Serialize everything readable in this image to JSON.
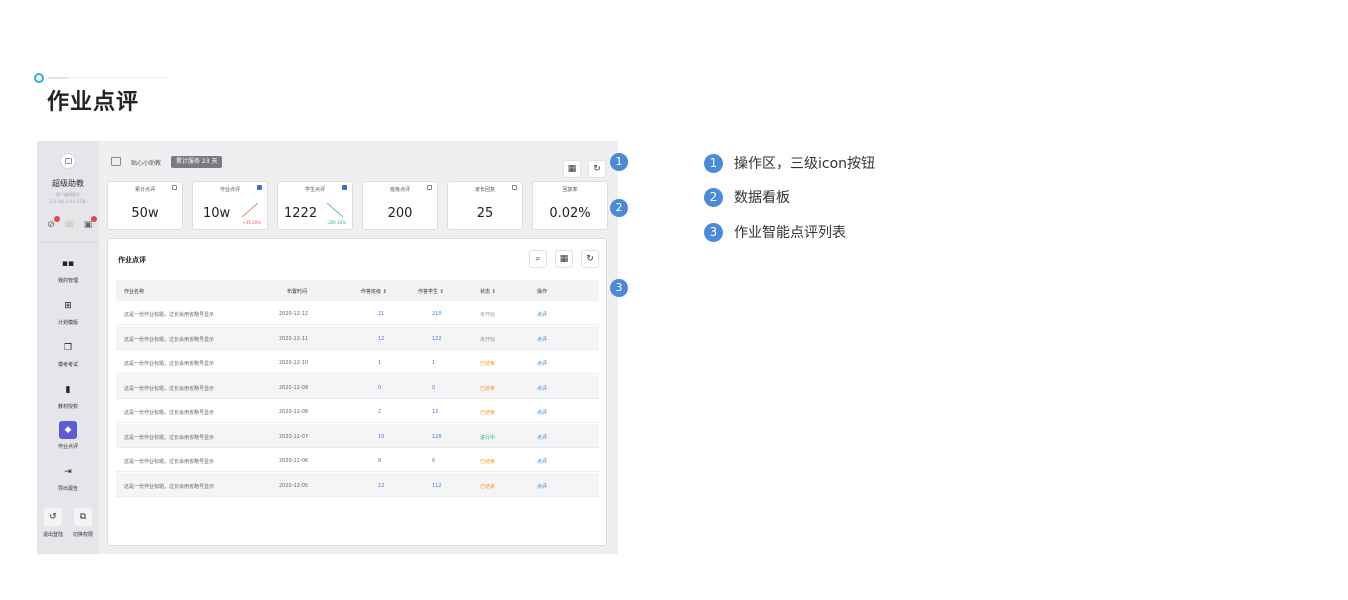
{
  "page": {
    "title": "作业点评"
  },
  "sidebar": {
    "name": "超级助教",
    "sub1": "客户编辑备号",
    "sub2": "2.0.0版 2.0.0 11款",
    "nav": [
      {
        "label": "我的管理",
        "icon": "grid-icon"
      },
      {
        "label": "计划模版",
        "icon": "table-icon"
      },
      {
        "label": "模考考试",
        "icon": "copy-icon"
      },
      {
        "label": "教材授权",
        "icon": "book-icon"
      },
      {
        "label": "作业点评",
        "icon": "eraser-icon",
        "active": true
      },
      {
        "label": "导出报告",
        "icon": "export-icon"
      }
    ],
    "bottom": [
      {
        "label": "退出登陆",
        "icon": "logout-icon"
      },
      {
        "label": "切换权限",
        "icon": "switch-icon"
      }
    ]
  },
  "topbar": {
    "name": "贴心小助教",
    "badge": "累计服务 23 天"
  },
  "cards": [
    {
      "label": "累计点评",
      "value": "50w"
    },
    {
      "label": "作业点评",
      "value": "10w",
      "delta_up": "+35",
      "delta_pct": "20%"
    },
    {
      "label": "学生点评",
      "value": "1222",
      "delta_down": "-200",
      "delta_pct": "20%"
    },
    {
      "label": "班级点评",
      "value": "200"
    },
    {
      "label": "家长回复",
      "value": "25"
    },
    {
      "label": "回复率",
      "value": "0.02%"
    }
  ],
  "panel": {
    "title": "作业点评",
    "columns": [
      "作业名称",
      "布置时间",
      "作答班级",
      "作答学生",
      "状态",
      "操作"
    ],
    "rows": [
      {
        "name": "这是一份作业标题，过长会用省略号显示",
        "date": "2020-12-12",
        "classes": "21",
        "students": "210",
        "status": "未开始",
        "status_type": "not",
        "action": "点评"
      },
      {
        "name": "这是一份作业标题，过长会用省略号显示",
        "date": "2020-12-11",
        "classes": "12",
        "students": "122",
        "status": "未开始",
        "status_type": "not",
        "action": "点评"
      },
      {
        "name": "这是一份作业标题，过长会用省略号显示",
        "date": "2020-12-10",
        "classes": "1",
        "students": "1",
        "status": "已结束",
        "status_type": "end",
        "action": "点评"
      },
      {
        "name": "这是一份作业标题，过长会用省略号显示",
        "date": "2020-12-09",
        "classes": "0",
        "students": "0",
        "status": "已结束",
        "status_type": "end",
        "action": "点评"
      },
      {
        "name": "这是一份作业标题，过长会用省略号显示",
        "date": "2020-12-08",
        "classes": "2",
        "students": "12",
        "status": "已结束",
        "status_type": "end",
        "action": "点评"
      },
      {
        "name": "这是一份作业标题，过长会用省略号显示",
        "date": "2020-12-07",
        "classes": "10",
        "students": "120",
        "status": "进行中",
        "status_type": "run",
        "action": "点评"
      },
      {
        "name": "这是一份作业标题，过长会用省略号显示",
        "date": "2020-12-06",
        "classes": "8",
        "students": "6",
        "status": "已结束",
        "status_type": "end",
        "action": "点评"
      },
      {
        "name": "这是一份作业标题，过长会用省略号显示",
        "date": "2020-12-05",
        "classes": "12",
        "students": "112",
        "status": "已结束",
        "status_type": "end",
        "action": "点评"
      }
    ]
  },
  "legend": [
    {
      "num": "1",
      "text": "操作区，三级icon按钮"
    },
    {
      "num": "2",
      "text": "数据看板"
    },
    {
      "num": "3",
      "text": "作业智能点评列表"
    }
  ],
  "colors": {
    "accent": "#4a8ad8",
    "active_nav": "#5b5bd6",
    "link": "#3b7fd6",
    "ended": "#f0a020",
    "running": "#2fb36a"
  }
}
